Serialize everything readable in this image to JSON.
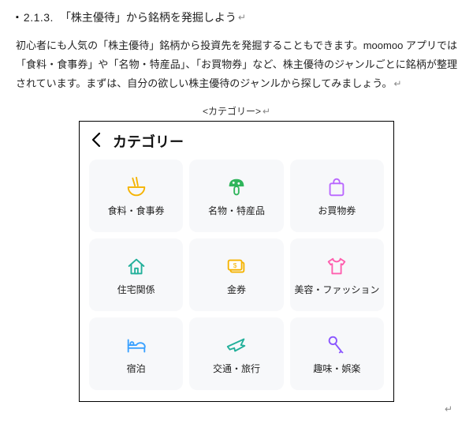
{
  "heading": {
    "number": "2.1.3.",
    "title": "「株主優待」から銘柄を発掘しよう",
    "return_mark": "↵"
  },
  "paragraph": {
    "text": "初心者にも人気の「株主優待」銘柄から投資先を発掘することもできます。moomoo アプリでは「食料・食事券」や「名物・特産品」、「お買物券」など、株主優待のジャンルごとに銘柄が整理されています。まずは、自分の欲しい株主優待のジャンルから探してみましょう。",
    "return_mark": "↵"
  },
  "caption": {
    "text": "<カテゴリー>",
    "return_mark": "↵"
  },
  "screenshot": {
    "title": "カテゴリー",
    "categories": [
      {
        "id": "food",
        "label": "食料・食事券",
        "icon": "noodle-bowl",
        "color": "#f5b301"
      },
      {
        "id": "specialty",
        "label": "名物・特産品",
        "icon": "mushroom",
        "color": "#2fb55b"
      },
      {
        "id": "shopping",
        "label": "お買物券",
        "icon": "shopping-bag",
        "color": "#b966ff"
      },
      {
        "id": "housing",
        "label": "住宅関係",
        "icon": "house",
        "color": "#22b09a"
      },
      {
        "id": "voucher",
        "label": "金券",
        "icon": "cash-voucher",
        "color": "#f5b301"
      },
      {
        "id": "beauty",
        "label": "美容・ファッション",
        "icon": "tshirt",
        "color": "#ff5eae"
      },
      {
        "id": "lodging",
        "label": "宿泊",
        "icon": "bed",
        "color": "#3aa1ff"
      },
      {
        "id": "travel",
        "label": "交通・旅行",
        "icon": "airplane",
        "color": "#22b09a"
      },
      {
        "id": "hobby",
        "label": "趣味・娯楽",
        "icon": "microphone",
        "color": "#8a55ff"
      }
    ]
  },
  "trailing_mark": "↵"
}
